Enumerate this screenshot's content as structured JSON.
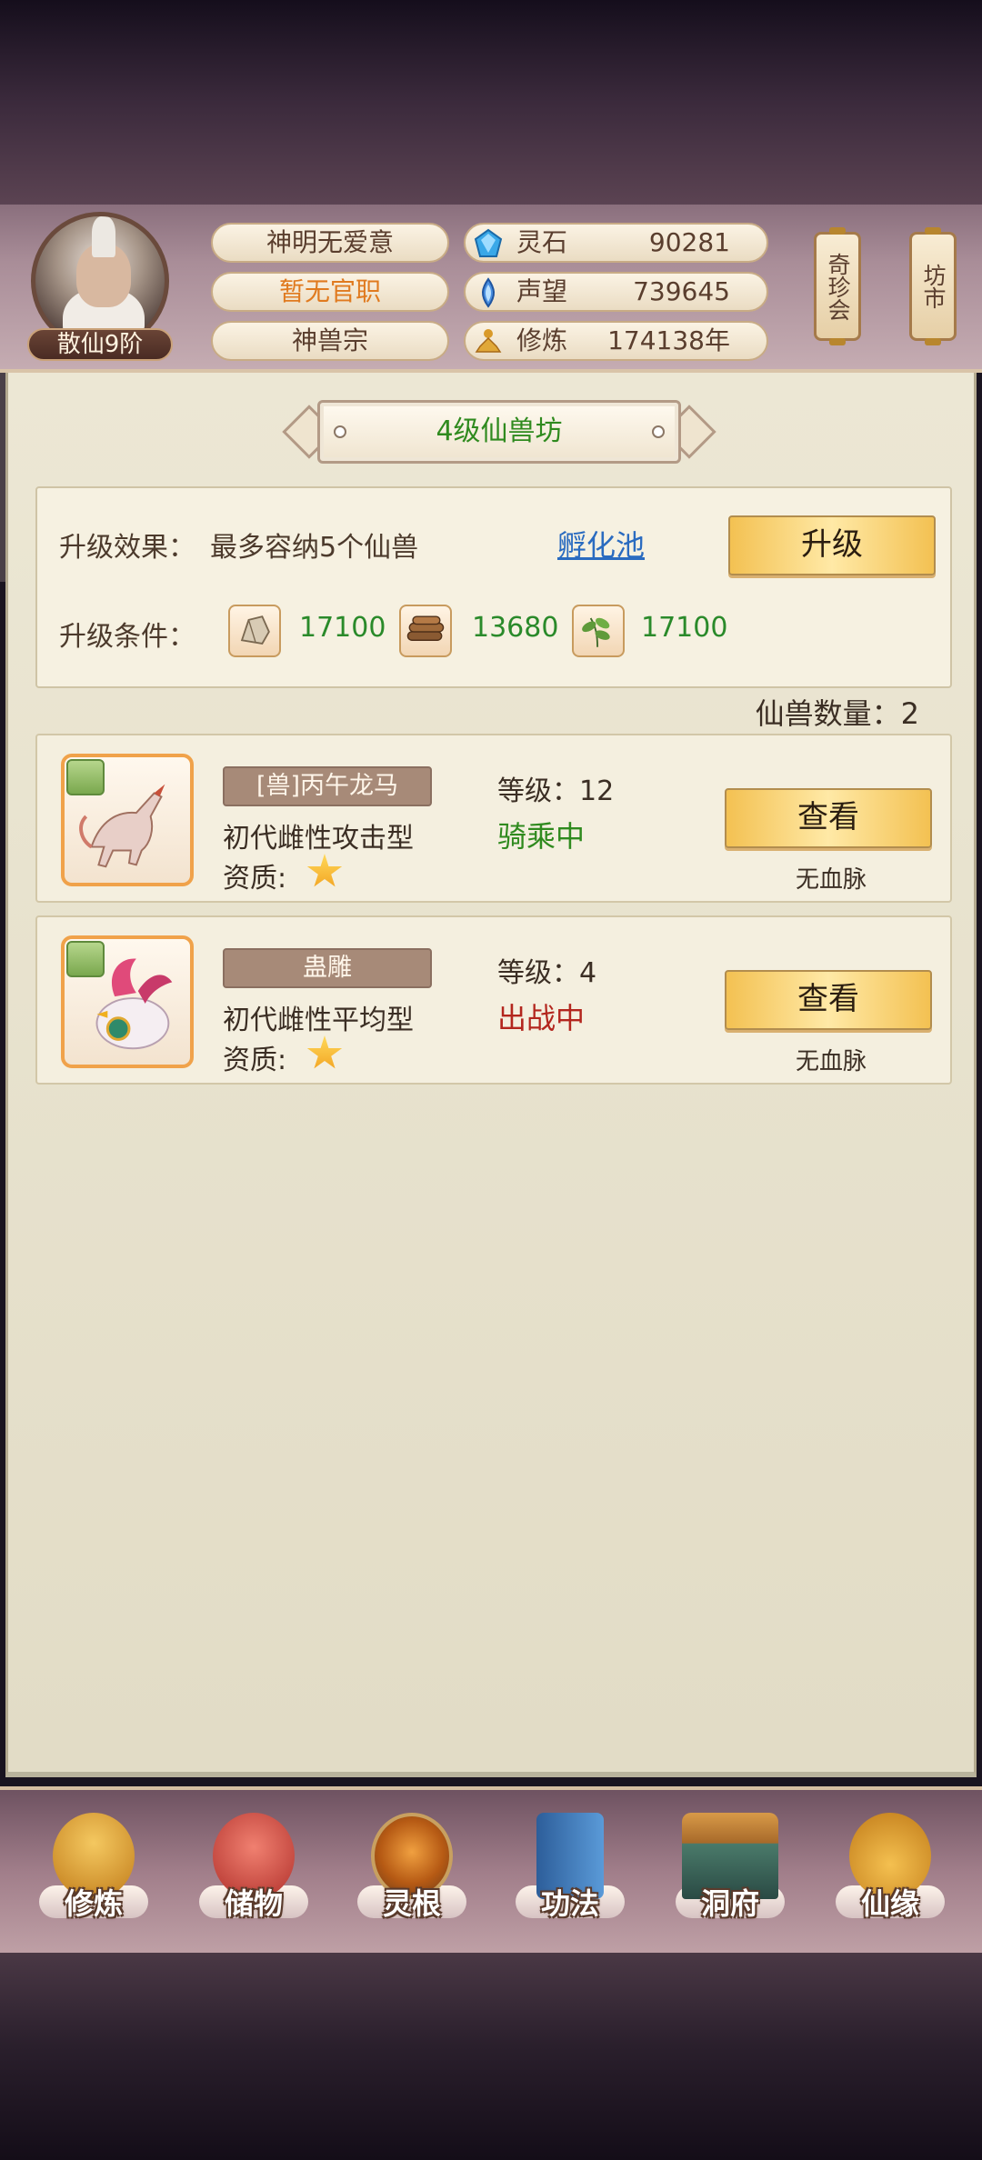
{
  "header": {
    "rank": "散仙9阶",
    "player_name": "神明无爱意",
    "official_title": "暂无官职",
    "sect": "神兽宗",
    "resources": [
      {
        "name": "灵石",
        "value": "90281",
        "icon": "spirit-stone-icon"
      },
      {
        "name": "声望",
        "value": "739645",
        "icon": "prestige-icon"
      },
      {
        "name": "修炼",
        "value": "174138年",
        "icon": "meditation-icon"
      }
    ],
    "right_buttons": [
      "奇珍会",
      "坊市"
    ]
  },
  "panel": {
    "title": "4级仙兽坊",
    "upgrade_effect_label": "升级效果：",
    "upgrade_effect_value": "最多容纳5个仙兽",
    "hatch_link": "孵化池",
    "upgrade_button": "升级",
    "upgrade_cond_label": "升级条件：",
    "materials": [
      {
        "icon": "ore-icon",
        "value": "17100"
      },
      {
        "icon": "wood-icon",
        "value": "13680"
      },
      {
        "icon": "herb-icon",
        "value": "17100"
      }
    ],
    "pet_count": "仙兽数量：2"
  },
  "pets": [
    {
      "name": "[兽]丙午龙马",
      "type": "初代雌性攻击型",
      "quality_label": "资质:",
      "level": "等级：12",
      "status": "骑乘中",
      "status_color": "#2f8a1e",
      "view_button": "查看",
      "bloodline": "无血脉"
    },
    {
      "name": "蛊雕",
      "type": "初代雌性平均型",
      "quality_label": "资质:",
      "level": "等级：4",
      "status": "出战中",
      "status_color": "#b3261e",
      "view_button": "查看",
      "bloodline": "无血脉"
    }
  ],
  "nav": [
    {
      "label": "修炼",
      "icon": "cultivate-icon",
      "color": "#d99a2a"
    },
    {
      "label": "储物",
      "icon": "storage-bag-icon",
      "color": "#d0504a"
    },
    {
      "label": "灵根",
      "icon": "spirit-root-icon",
      "color": "#c86a1e"
    },
    {
      "label": "功法",
      "icon": "manual-book-icon",
      "color": "#3c78b8"
    },
    {
      "label": "洞府",
      "icon": "cave-mansion-icon",
      "color": "#b87a3a"
    },
    {
      "label": "仙缘",
      "icon": "gourd-icon",
      "color": "#e0a830"
    }
  ]
}
